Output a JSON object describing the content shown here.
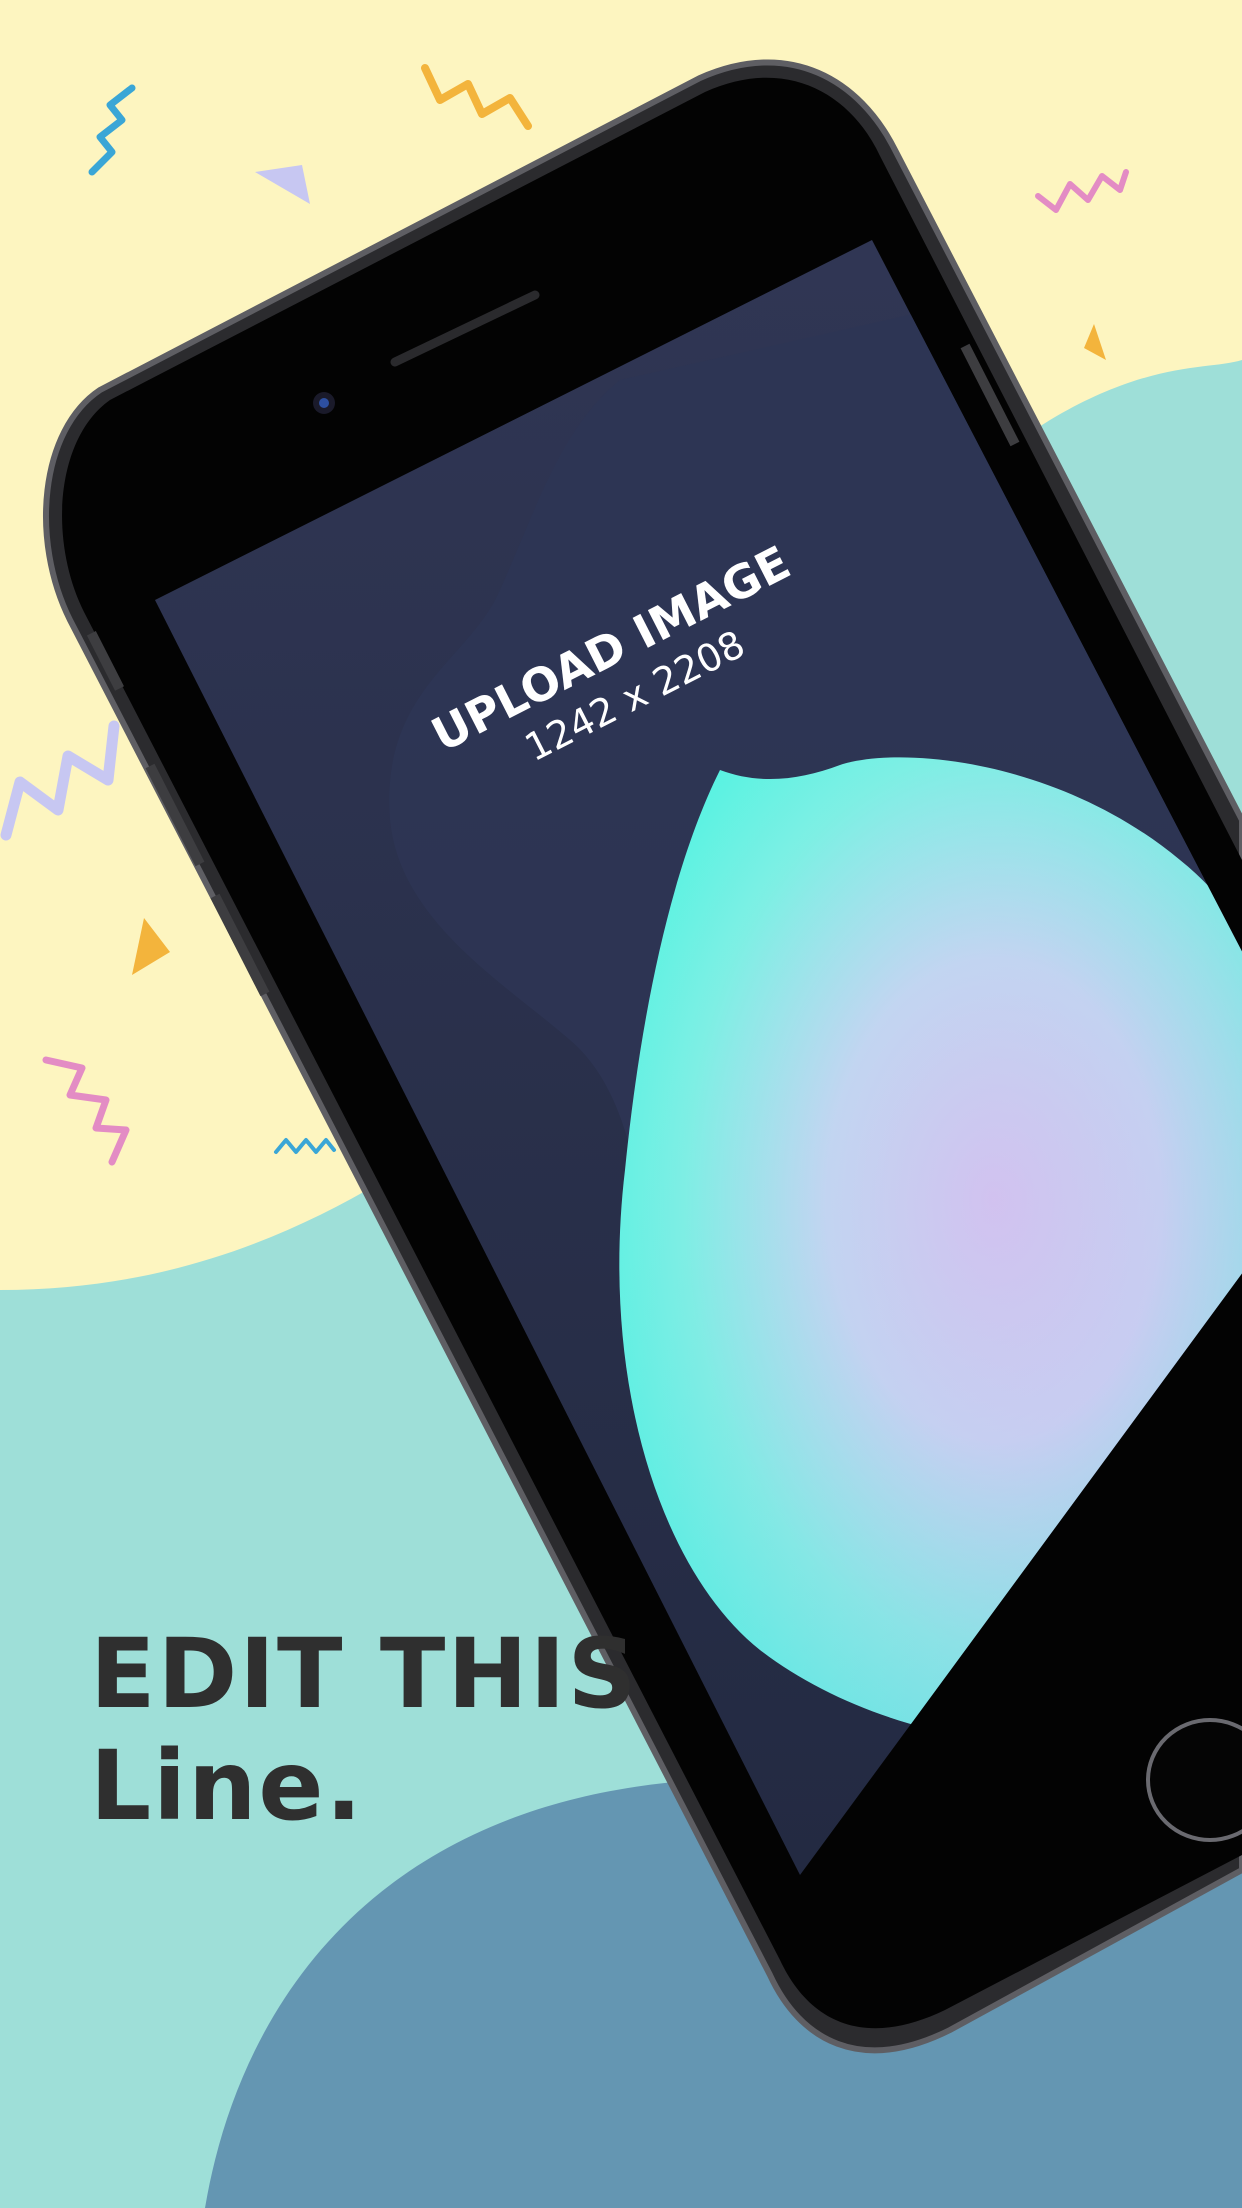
{
  "screen": {
    "upload_title": "UPLOAD IMAGE",
    "upload_size": "1242 x 2208"
  },
  "headline": {
    "line1": "EDIT THIS",
    "line2": "Line."
  },
  "colors": {
    "background_yellow": "#fdf5c0",
    "teal_blob": "#9edfd8",
    "blue_blob": "#6496b2",
    "screen_dark": "#2a3150",
    "text_dark": "#2f2f2f"
  }
}
